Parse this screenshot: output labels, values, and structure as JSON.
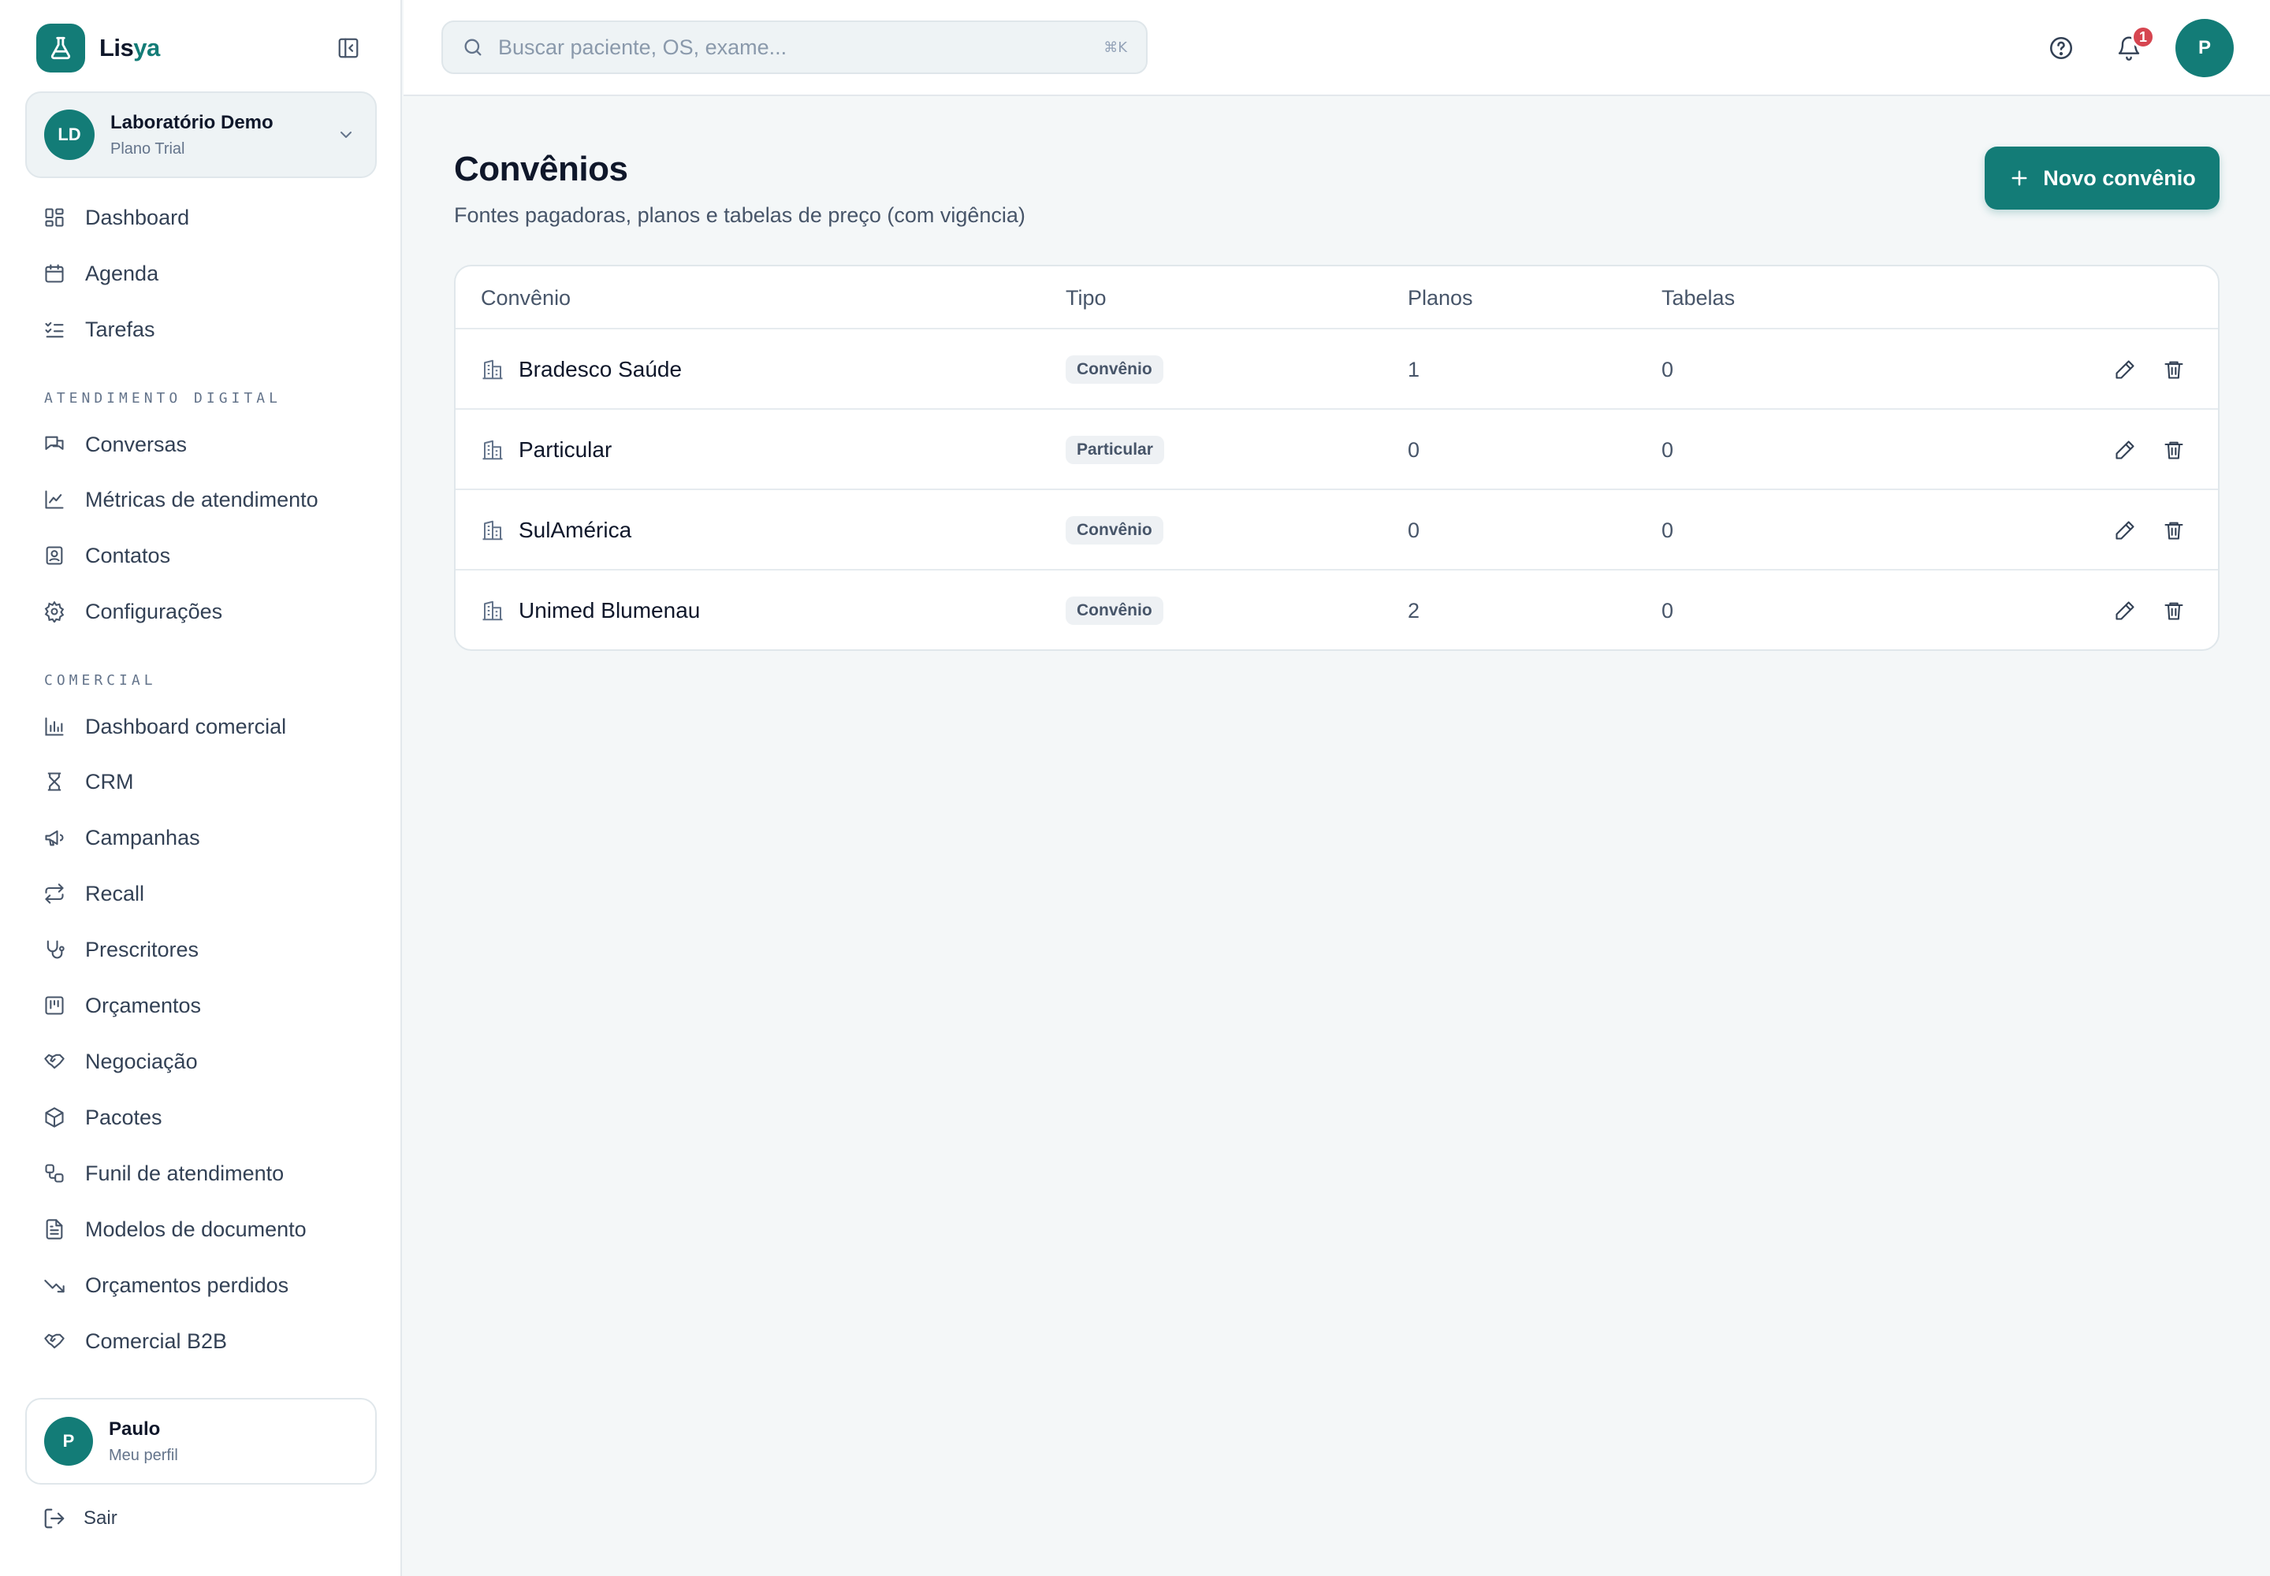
{
  "brand": {
    "name_main": "Lis",
    "name_accent": "ya"
  },
  "org": {
    "initials": "LD",
    "name": "Laboratório Demo",
    "plan": "Plano Trial"
  },
  "nav": {
    "main": [
      {
        "label": "Dashboard",
        "icon": "dashboard-icon"
      },
      {
        "label": "Agenda",
        "icon": "calendar-icon"
      },
      {
        "label": "Tarefas",
        "icon": "tasks-icon"
      }
    ],
    "sections": [
      {
        "title": "Atendimento digital",
        "items": [
          {
            "label": "Conversas",
            "icon": "chat-icon"
          },
          {
            "label": "Métricas de atendimento",
            "icon": "line-chart-icon"
          },
          {
            "label": "Contatos",
            "icon": "contacts-icon"
          },
          {
            "label": "Configurações",
            "icon": "gear-icon"
          }
        ]
      },
      {
        "title": "Comercial",
        "items": [
          {
            "label": "Dashboard comercial",
            "icon": "bar-chart-icon"
          },
          {
            "label": "CRM",
            "icon": "crm-icon"
          },
          {
            "label": "Campanhas",
            "icon": "megaphone-icon"
          },
          {
            "label": "Recall",
            "icon": "repeat-icon"
          },
          {
            "label": "Prescritores",
            "icon": "stethoscope-icon"
          },
          {
            "label": "Orçamentos",
            "icon": "kanban-icon"
          },
          {
            "label": "Negociação",
            "icon": "handshake-icon"
          },
          {
            "label": "Pacotes",
            "icon": "package-icon"
          },
          {
            "label": "Funil de atendimento",
            "icon": "workflow-icon"
          },
          {
            "label": "Modelos de documento",
            "icon": "document-icon"
          },
          {
            "label": "Orçamentos perdidos",
            "icon": "trending-down-icon"
          },
          {
            "label": "Comercial B2B",
            "icon": "handshake-icon"
          }
        ]
      }
    ]
  },
  "user": {
    "initial": "P",
    "name": "Paulo",
    "sub": "Meu perfil"
  },
  "logout_label": "Sair",
  "search": {
    "placeholder": "Buscar paciente, OS, exame...",
    "shortcut": "⌘K"
  },
  "topbar": {
    "notifications_count": "1",
    "avatar_initial": "P"
  },
  "page": {
    "title": "Convênios",
    "subtitle": "Fontes pagadoras, planos e tabelas de preço (com vigência)",
    "new_button": "Novo convênio"
  },
  "table": {
    "headers": {
      "name": "Convênio",
      "type": "Tipo",
      "plans": "Planos",
      "tables": "Tabelas"
    },
    "rows": [
      {
        "name": "Bradesco Saúde",
        "type": "Convênio",
        "plans": "1",
        "tables": "0"
      },
      {
        "name": "Particular",
        "type": "Particular",
        "plans": "0",
        "tables": "0"
      },
      {
        "name": "SulAmérica",
        "type": "Convênio",
        "plans": "0",
        "tables": "0"
      },
      {
        "name": "Unimed Blumenau",
        "type": "Convênio",
        "plans": "2",
        "tables": "0"
      }
    ]
  },
  "colors": {
    "accent": "#137c77",
    "badge_alert": "#d64550"
  }
}
